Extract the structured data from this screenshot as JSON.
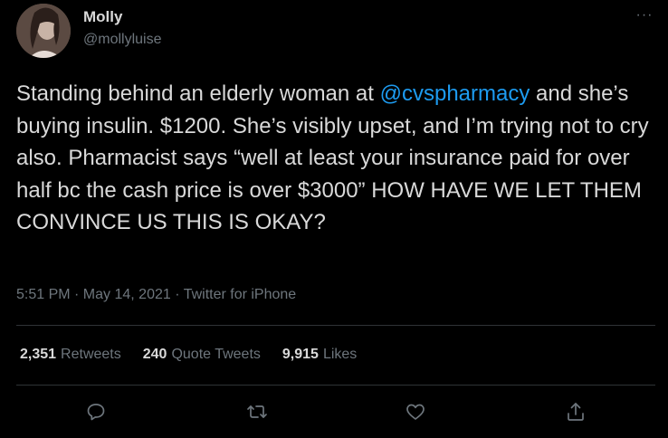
{
  "author": {
    "name": "Molly",
    "handle": "@mollyluise"
  },
  "tweet": {
    "text_before": "Standing behind an elderly woman at ",
    "mention": "@cvspharmacy",
    "text_after": " and she’s buying insulin. $1200. She’s visibly upset, and I’m trying not to cry also. Pharmacist says “well at least your insurance paid for over half bc the cash price is over $3000” HOW HAVE WE LET THEM CONVINCE US THIS IS OKAY?",
    "meta": "5:51 PM · May 14, 2021 · Twitter for iPhone"
  },
  "stats": {
    "retweets_count": "2,351",
    "retweets_label": "Retweets",
    "quotes_count": "240",
    "quotes_label": "Quote Tweets",
    "likes_count": "9,915",
    "likes_label": "Likes"
  },
  "menu": {
    "more_label": "···"
  },
  "actions": [
    "reply-icon",
    "retweet-icon",
    "like-icon",
    "share-icon"
  ],
  "colors": {
    "background": "#000000",
    "text": "#d9d9d9",
    "muted": "#6e767d",
    "link": "#1d9bf0",
    "divider": "#2f3336"
  }
}
